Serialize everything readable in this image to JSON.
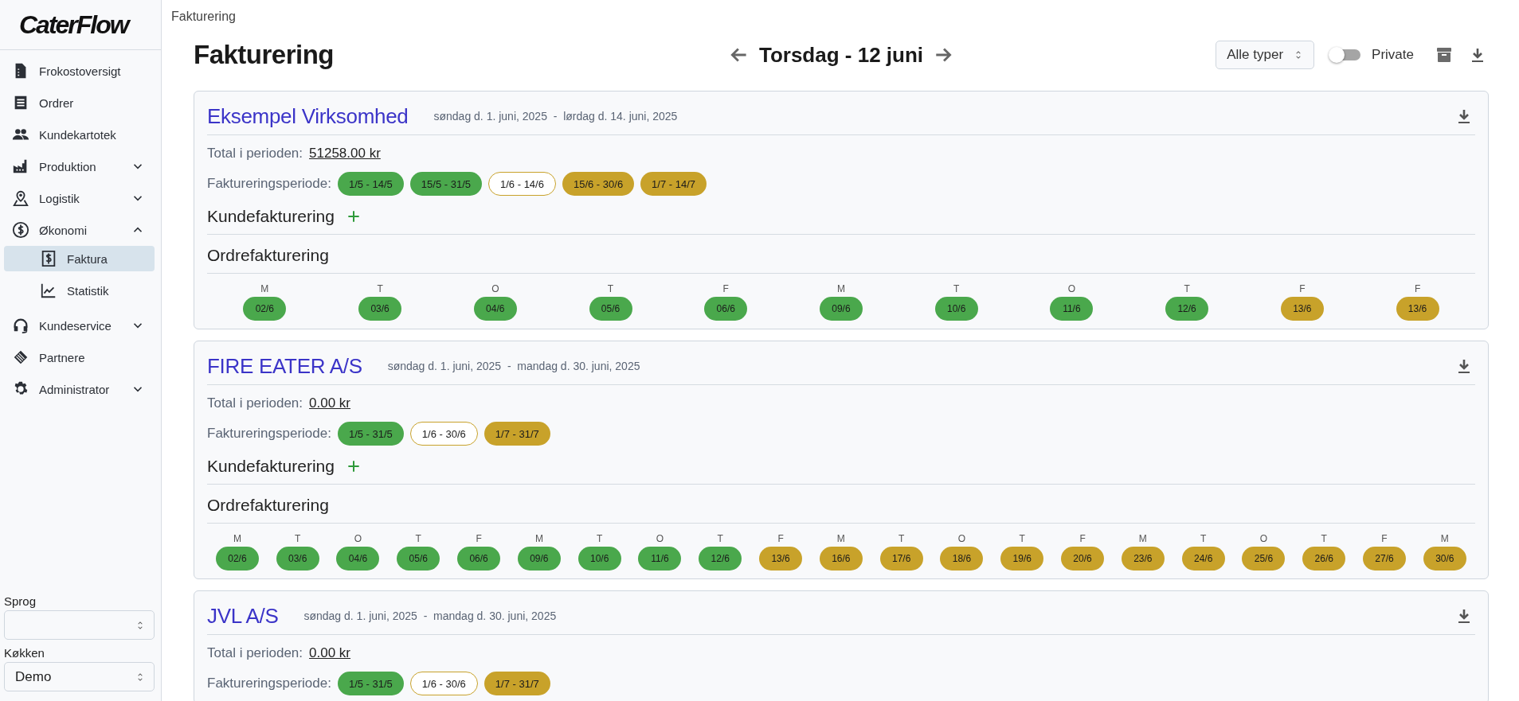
{
  "logo": "CaterFlow",
  "sidebar": {
    "items": [
      {
        "label": "Frokostoversigt",
        "selected": false
      },
      {
        "label": "Ordrer",
        "selected": false
      },
      {
        "label": "Kundekartotek",
        "selected": false
      },
      {
        "label": "Produktion",
        "selected": false,
        "expanded": false
      },
      {
        "label": "Logistik",
        "selected": false,
        "expanded": false
      },
      {
        "label": "Økonomi",
        "selected": false,
        "expanded": true,
        "children": [
          {
            "label": "Faktura",
            "selected": true
          },
          {
            "label": "Statistik",
            "selected": false
          }
        ]
      },
      {
        "label": "Kundeservice",
        "selected": false,
        "expanded": false
      },
      {
        "label": "Partnere",
        "selected": false
      },
      {
        "label": "Administrator",
        "selected": false,
        "expanded": false
      }
    ],
    "fields": [
      {
        "label": "Sprog"
      },
      {
        "label": "Køkken",
        "value": "Demo"
      }
    ]
  },
  "breadcrumb": "Fakturering",
  "title": "Fakturering",
  "date_nav": {
    "label": "Torsdag - 12 juni"
  },
  "type_filter": {
    "value": "Alle typer"
  },
  "private_toggle": {
    "label": "Private",
    "on": false
  },
  "cards": [
    {
      "name": "Eksempel Virksomhed",
      "period": "søndag d. 1. juni, 2025  -  lørdag d. 14. juni, 2025",
      "total_label": "Total i perioden:",
      "total": "51258.00 kr",
      "period_label": "Faktureringsperiode:",
      "periods": [
        {
          "label": "1/5 - 14/5",
          "kind": "done"
        },
        {
          "label": "15/5 - 31/5",
          "kind": "done"
        },
        {
          "label": "1/6 - 14/6",
          "kind": "current"
        },
        {
          "label": "15/6 - 30/6",
          "kind": "pending"
        },
        {
          "label": "1/7 - 14/7",
          "kind": "pending"
        }
      ],
      "customer_billing": "Kundefakturering",
      "order_billing": "Ordrefakturering",
      "days": [
        {
          "weekday": "M",
          "date": "02/6",
          "kind": "done"
        },
        {
          "weekday": "T",
          "date": "03/6",
          "kind": "done"
        },
        {
          "weekday": "O",
          "date": "04/6",
          "kind": "done"
        },
        {
          "weekday": "T",
          "date": "05/6",
          "kind": "done"
        },
        {
          "weekday": "F",
          "date": "06/6",
          "kind": "done"
        },
        {
          "weekday": "M",
          "date": "09/6",
          "kind": "done"
        },
        {
          "weekday": "T",
          "date": "10/6",
          "kind": "done"
        },
        {
          "weekday": "O",
          "date": "11/6",
          "kind": "done"
        },
        {
          "weekday": "T",
          "date": "12/6",
          "kind": "done"
        },
        {
          "weekday": "F",
          "date": "13/6",
          "kind": "pending"
        },
        {
          "weekday": "F",
          "date": "13/6",
          "kind": "pending"
        }
      ]
    },
    {
      "name": "FIRE EATER A/S",
      "period": "søndag d. 1. juni, 2025  -  mandag d. 30. juni, 2025",
      "total_label": "Total i perioden:",
      "total": "0.00 kr",
      "period_label": "Faktureringsperiode:",
      "periods": [
        {
          "label": "1/5 - 31/5",
          "kind": "done"
        },
        {
          "label": "1/6 - 30/6",
          "kind": "current"
        },
        {
          "label": "1/7 - 31/7",
          "kind": "pending"
        }
      ],
      "customer_billing": "Kundefakturering",
      "order_billing": "Ordrefakturering",
      "days": [
        {
          "weekday": "M",
          "date": "02/6",
          "kind": "done"
        },
        {
          "weekday": "T",
          "date": "03/6",
          "kind": "done"
        },
        {
          "weekday": "O",
          "date": "04/6",
          "kind": "done"
        },
        {
          "weekday": "T",
          "date": "05/6",
          "kind": "done"
        },
        {
          "weekday": "F",
          "date": "06/6",
          "kind": "done"
        },
        {
          "weekday": "M",
          "date": "09/6",
          "kind": "done"
        },
        {
          "weekday": "T",
          "date": "10/6",
          "kind": "done"
        },
        {
          "weekday": "O",
          "date": "11/6",
          "kind": "done"
        },
        {
          "weekday": "T",
          "date": "12/6",
          "kind": "done"
        },
        {
          "weekday": "F",
          "date": "13/6",
          "kind": "pending"
        },
        {
          "weekday": "M",
          "date": "16/6",
          "kind": "pending"
        },
        {
          "weekday": "T",
          "date": "17/6",
          "kind": "pending"
        },
        {
          "weekday": "O",
          "date": "18/6",
          "kind": "pending"
        },
        {
          "weekday": "T",
          "date": "19/6",
          "kind": "pending"
        },
        {
          "weekday": "F",
          "date": "20/6",
          "kind": "pending"
        },
        {
          "weekday": "M",
          "date": "23/6",
          "kind": "pending"
        },
        {
          "weekday": "T",
          "date": "24/6",
          "kind": "pending"
        },
        {
          "weekday": "O",
          "date": "25/6",
          "kind": "pending"
        },
        {
          "weekday": "T",
          "date": "26/6",
          "kind": "pending"
        },
        {
          "weekday": "F",
          "date": "27/6",
          "kind": "pending"
        },
        {
          "weekday": "M",
          "date": "30/6",
          "kind": "pending"
        }
      ]
    },
    {
      "name": "JVL A/S",
      "period": "søndag d. 1. juni, 2025  -  mandag d. 30. juni, 2025",
      "total_label": "Total i perioden:",
      "total": "0.00 kr",
      "period_label": "Faktureringsperiode:",
      "periods": [
        {
          "label": "1/5 - 31/5",
          "kind": "done"
        },
        {
          "label": "1/6 - 30/6",
          "kind": "current"
        },
        {
          "label": "1/7 - 31/7",
          "kind": "pending"
        }
      ]
    }
  ]
}
